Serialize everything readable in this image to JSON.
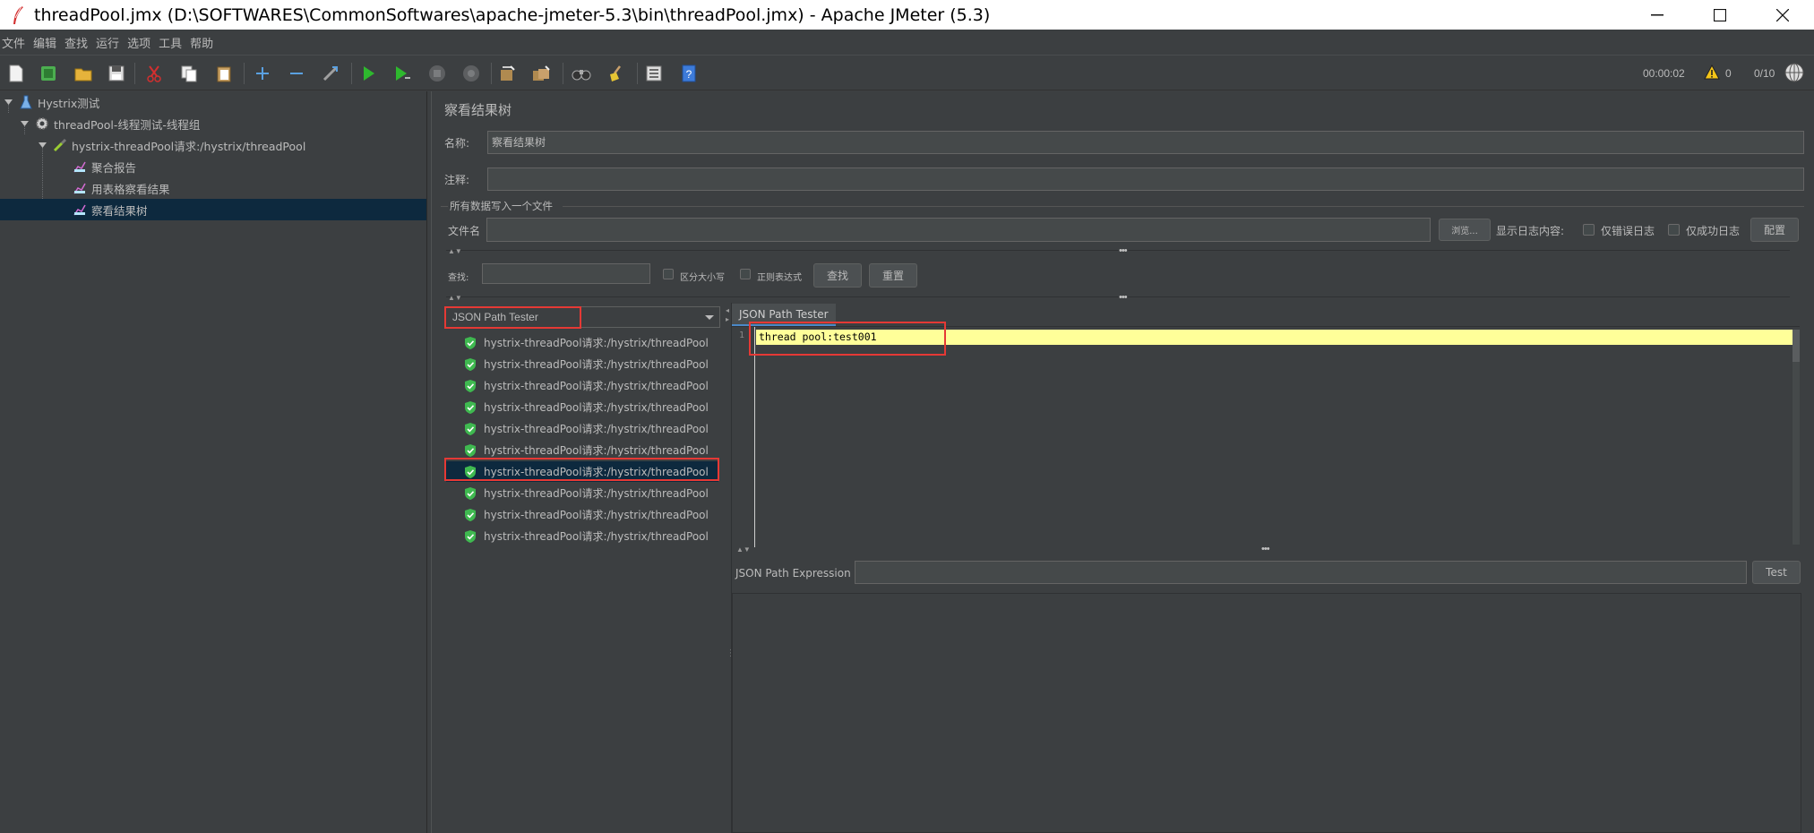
{
  "window": {
    "title": "threadPool.jmx (D:\\SOFTWARES\\CommonSoftwares\\apache-jmeter-5.3\\bin\\threadPool.jmx) - Apache JMeter (5.3)"
  },
  "menubar": [
    "文件",
    "编辑",
    "查找",
    "运行",
    "选项",
    "工具",
    "帮助"
  ],
  "toolbar": {
    "elapsed_time": "00:00:02",
    "warning_count": "0",
    "threads": "0/10"
  },
  "tree": {
    "nodes": [
      {
        "label": "Hystrix测试",
        "icon": "flask-icon"
      },
      {
        "label": "threadPool-线程测试-线程组",
        "icon": "gear-icon"
      },
      {
        "label": "hystrix-threadPool请求:/hystrix/threadPool",
        "icon": "pipette-icon"
      },
      {
        "label": "聚合报告",
        "icon": "chart-icon"
      },
      {
        "label": "用表格察看结果",
        "icon": "chart-icon"
      },
      {
        "label": "察看结果树",
        "icon": "chart-icon"
      }
    ]
  },
  "panel": {
    "title": "察看结果树",
    "name_label": "名称:",
    "name_value": "察看结果树",
    "comment_label": "注释:",
    "comment_value": "",
    "file_group_title": "所有数据写入一个文件",
    "filename_label": "文件名",
    "filename_value": "",
    "browse_label": "浏览...",
    "log_content_label": "显示日志内容:",
    "errors_only_label": "仅错误日志",
    "success_only_label": "仅成功日志",
    "configure_label": "配置"
  },
  "search": {
    "label": "查找:",
    "value": "",
    "case_sensitive_label": "区分大小写",
    "regex_label": "正则表达式",
    "find_label": "查找",
    "reset_label": "重置"
  },
  "results": {
    "renderer": "JSON Path Tester",
    "samples": [
      "hystrix-threadPool请求:/hystrix/threadPool",
      "hystrix-threadPool请求:/hystrix/threadPool",
      "hystrix-threadPool请求:/hystrix/threadPool",
      "hystrix-threadPool请求:/hystrix/threadPool",
      "hystrix-threadPool请求:/hystrix/threadPool",
      "hystrix-threadPool请求:/hystrix/threadPool",
      "hystrix-threadPool请求:/hystrix/threadPool",
      "hystrix-threadPool请求:/hystrix/threadPool",
      "hystrix-threadPool请求:/hystrix/threadPool",
      "hystrix-threadPool请求:/hystrix/threadPool"
    ],
    "selected_index": 6
  },
  "tester": {
    "tab_label": "JSON Path Tester",
    "line_number": "1",
    "response_text": "thread pool:test001",
    "expression_label": "JSON Path Expression",
    "expression_value": "",
    "test_label": "Test"
  },
  "colors": {
    "background": "#3c3f41",
    "selection": "#0d293e",
    "highlight_line": "#ffff99",
    "annotation_red": "#e53935",
    "success_green": "#3fb950"
  }
}
